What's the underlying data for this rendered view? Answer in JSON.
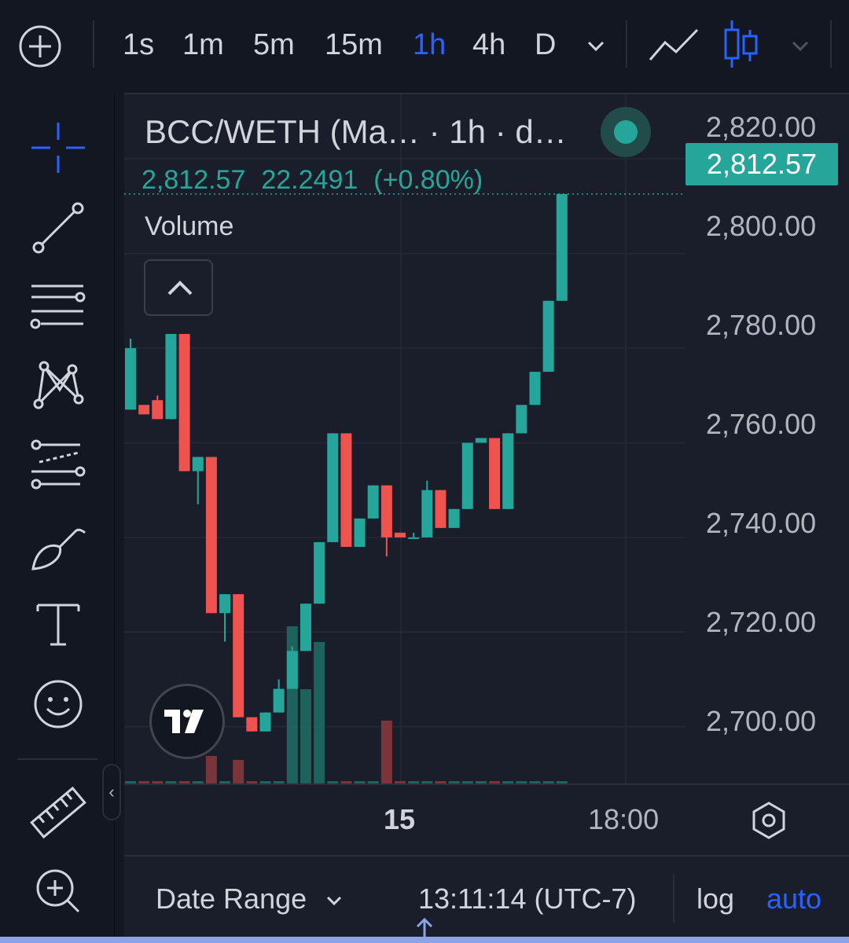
{
  "toolbar": {
    "intervals": [
      {
        "label": "1s",
        "active": false
      },
      {
        "label": "1m",
        "active": false
      },
      {
        "label": "5m",
        "active": false
      },
      {
        "label": "15m",
        "active": false
      },
      {
        "label": "1h",
        "active": true
      },
      {
        "label": "4h",
        "active": false
      },
      {
        "label": "D",
        "active": false
      }
    ],
    "icons": [
      "add-circle-icon",
      "chevron-down-icon",
      "line-chart-icon",
      "candles-icon",
      "chevron-down-icon"
    ],
    "accent_color": "#2962ff"
  },
  "left_toolbar": {
    "tools": [
      "crosshair-icon",
      "trend-line-icon",
      "horizontal-lines-icon",
      "pattern-icon",
      "fib-icon",
      "brush-icon",
      "text-icon",
      "emoji-icon",
      "ruler-icon",
      "zoom-in-icon"
    ]
  },
  "legend": {
    "title": "BCC/WETH (Ma…  · 1h · d…",
    "close": "2,812.57",
    "change": "22.2491",
    "change_pct": "(+0.80%)",
    "volume_label": "Volume",
    "up_color": "#26a69a",
    "down_color": "#ef5350"
  },
  "price_axis": {
    "labels": [
      "2,820.00",
      "2,800.00",
      "2,780.00",
      "2,760.00",
      "2,740.00",
      "2,720.00",
      "2,700.00"
    ],
    "last_price": "2,812.57"
  },
  "time_axis": {
    "labels": [
      {
        "text": "15",
        "bold": true
      },
      {
        "text": "18:00",
        "bold": false
      }
    ]
  },
  "bottom_bar": {
    "date_range": "Date Range",
    "clock": "13:11:14 (UTC-7)",
    "log": "log",
    "auto": "auto"
  },
  "chart_data": {
    "type": "candlestick",
    "interval": "1h",
    "ylim": [
      2688,
      2827
    ],
    "last": 2812.57,
    "candles": [
      {
        "o": 2767,
        "h": 2782,
        "l": 2767,
        "c": 2780
      },
      {
        "o": 2768,
        "h": 2768,
        "l": 2766,
        "c": 2766
      },
      {
        "o": 2769,
        "h": 2770,
        "l": 2765,
        "c": 2765
      },
      {
        "o": 2765,
        "h": 2783,
        "l": 2765,
        "c": 2783
      },
      {
        "o": 2783,
        "h": 2783,
        "l": 2754,
        "c": 2754
      },
      {
        "o": 2754,
        "h": 2757,
        "l": 2747,
        "c": 2757
      },
      {
        "o": 2757,
        "h": 2757,
        "l": 2724,
        "c": 2724
      },
      {
        "o": 2724,
        "h": 2728,
        "l": 2718,
        "c": 2728
      },
      {
        "o": 2728,
        "h": 2728,
        "l": 2702,
        "c": 2702
      },
      {
        "o": 2702,
        "h": 2702,
        "l": 2699,
        "c": 2699
      },
      {
        "o": 2699,
        "h": 2703,
        "l": 2699,
        "c": 2703
      },
      {
        "o": 2703,
        "h": 2710,
        "l": 2703,
        "c": 2708
      },
      {
        "o": 2708,
        "h": 2717,
        "l": 2708,
        "c": 2716
      },
      {
        "o": 2716,
        "h": 2726,
        "l": 2716,
        "c": 2726
      },
      {
        "o": 2726,
        "h": 2739,
        "l": 2726,
        "c": 2739
      },
      {
        "o": 2739,
        "h": 2762,
        "l": 2739,
        "c": 2762
      },
      {
        "o": 2762,
        "h": 2762,
        "l": 2738,
        "c": 2738
      },
      {
        "o": 2738,
        "h": 2744,
        "l": 2738,
        "c": 2744
      },
      {
        "o": 2744,
        "h": 2751,
        "l": 2744,
        "c": 2751
      },
      {
        "o": 2751,
        "h": 2751,
        "l": 2736,
        "c": 2740
      },
      {
        "o": 2741,
        "h": 2741,
        "l": 2740,
        "c": 2740
      },
      {
        "o": 2740,
        "h": 2741,
        "l": 2740,
        "c": 2740
      },
      {
        "o": 2740,
        "h": 2752,
        "l": 2740,
        "c": 2750
      },
      {
        "o": 2750,
        "h": 2750,
        "l": 2742,
        "c": 2742
      },
      {
        "o": 2742,
        "h": 2746,
        "l": 2742,
        "c": 2746
      },
      {
        "o": 2746,
        "h": 2760,
        "l": 2746,
        "c": 2760
      },
      {
        "o": 2760,
        "h": 2761,
        "l": 2760,
        "c": 2761
      },
      {
        "o": 2761,
        "h": 2761,
        "l": 2746,
        "c": 2746
      },
      {
        "o": 2746,
        "h": 2762,
        "l": 2746,
        "c": 2762
      },
      {
        "o": 2762,
        "h": 2768,
        "l": 2762,
        "c": 2768
      },
      {
        "o": 2768,
        "h": 2775,
        "l": 2768,
        "c": 2775
      },
      {
        "o": 2775,
        "h": 2790,
        "l": 2775,
        "c": 2790
      },
      {
        "o": 2790,
        "h": 2812.57,
        "l": 2790,
        "c": 2812.57
      }
    ],
    "volume": [
      2,
      0,
      0,
      0,
      0,
      0,
      35,
      0,
      30,
      0,
      0,
      0,
      200,
      120,
      180,
      0,
      0,
      0,
      0,
      80,
      0,
      0,
      0,
      0,
      0,
      0,
      0,
      0,
      0,
      0,
      0,
      0,
      0
    ]
  }
}
